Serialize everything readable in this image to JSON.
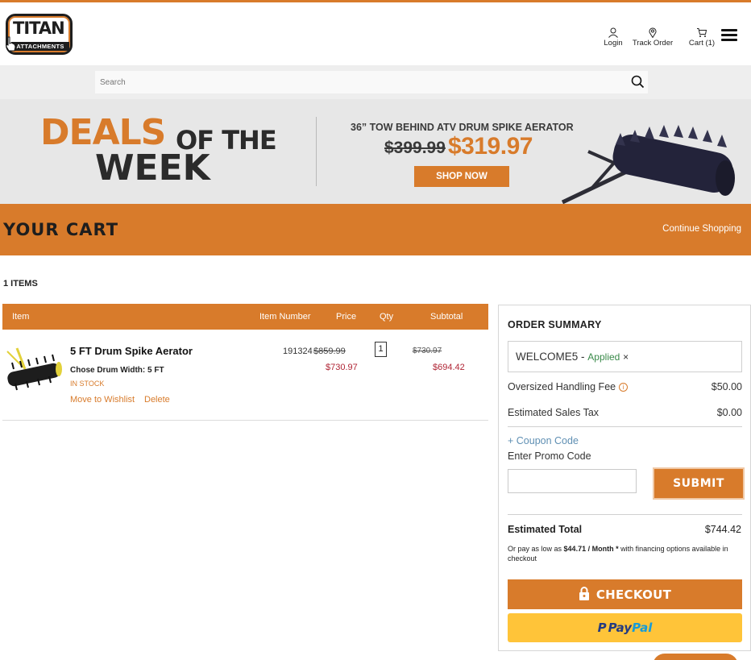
{
  "colors": {
    "accent": "#d87b2b",
    "sale": "#b02535",
    "applied": "#3a8a4a",
    "link": "#5f8fb3",
    "paypal_bg": "#ffc439"
  },
  "brand": {
    "logo_line1": "TITAN",
    "logo_line2": "ATTACHMENTS"
  },
  "header": {
    "login_label": "Login",
    "track_label": "Track Order",
    "cart_label": "Cart (1)"
  },
  "search": {
    "placeholder": "Search"
  },
  "banner": {
    "deals": "DEALS",
    "of_the": "OF THE",
    "week": "WEEK",
    "product": "36” TOW BEHIND ATV DRUM SPIKE AERATOR",
    "old_price": "$399.99",
    "new_price": "$319.97",
    "cta": "SHOP NOW"
  },
  "cart": {
    "title": "YOUR CART",
    "continue": "Continue Shopping",
    "items_count": "1 ITEMS",
    "columns": {
      "item": "Item",
      "item_number": "Item Number",
      "price": "Price",
      "qty": "Qty",
      "subtotal": "Subtotal"
    },
    "items": [
      {
        "name": "5 FT Drum Spike Aerator",
        "variant": "Chose Drum Width: 5 FT",
        "stock": "IN STOCK",
        "wishlist": "Move to Wishlist",
        "delete": "Delete",
        "item_number": "191324",
        "old_price": "$859.99",
        "price": "$730.97",
        "qty": "1",
        "old_subtotal": "$730.97",
        "subtotal": "$694.42"
      }
    ]
  },
  "summary": {
    "title": "ORDER SUMMARY",
    "coupon": {
      "code": "WELCOME5",
      "separator": "-",
      "status": "Applied",
      "remove": "×"
    },
    "handling_label": "Oversized Handling Fee",
    "handling_value": "$50.00",
    "tax_label": "Estimated Sales Tax",
    "tax_value": "$0.00",
    "coupon_link": "+ Coupon Code",
    "promo_label": "Enter Promo Code",
    "submit": "SUBMIT",
    "total_label": "Estimated Total",
    "total_value": "$744.42",
    "financing_prefix": "Or pay as low as",
    "financing_amount": "$44.71 / Month *",
    "financing_suffix": "with financing options available in checkout",
    "checkout": "CHECKOUT",
    "paypal_1": "Pay",
    "paypal_2": "Pal"
  },
  "icons": [
    "user-icon",
    "location-pin-icon",
    "cart-icon",
    "hamburger-menu-icon",
    "search-icon",
    "info-icon",
    "lock-icon",
    "paypal-icon"
  ]
}
